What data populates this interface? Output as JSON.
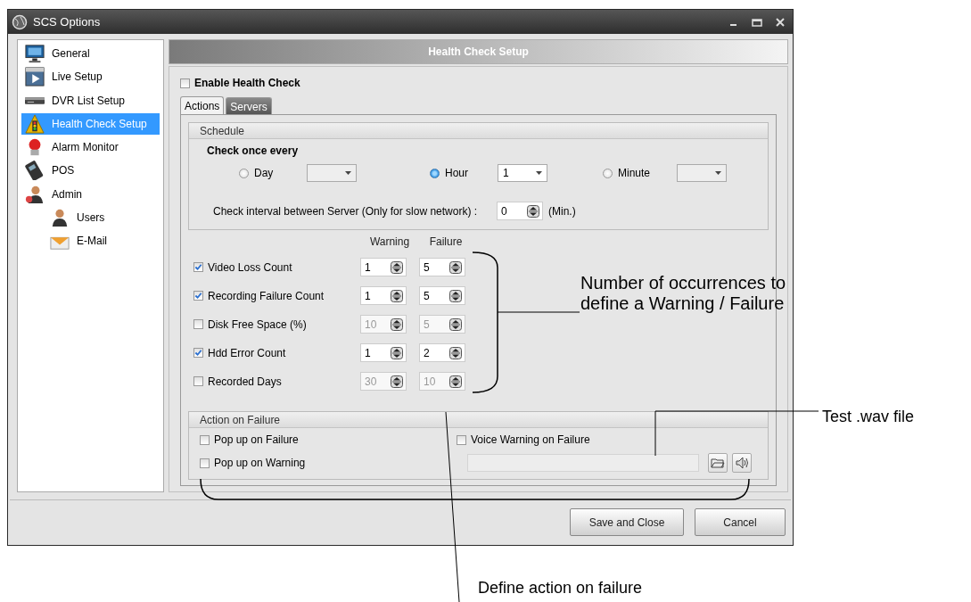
{
  "window": {
    "title": "SCS Options"
  },
  "sidebar": {
    "items": [
      {
        "label": "General",
        "selected": false
      },
      {
        "label": "Live Setup",
        "selected": false
      },
      {
        "label": "DVR List Setup",
        "selected": false
      },
      {
        "label": "Health Check Setup",
        "selected": true
      },
      {
        "label": "Alarm Monitor",
        "selected": false
      },
      {
        "label": "POS",
        "selected": false
      },
      {
        "label": "Admin",
        "selected": false,
        "children": [
          {
            "label": "Users",
            "selected": false
          },
          {
            "label": "E-Mail",
            "selected": false
          }
        ]
      }
    ]
  },
  "panel": {
    "title": "Health Check Setup",
    "enable": {
      "label": "Enable Health Check",
      "checked": false
    },
    "tabs": [
      {
        "label": "Actions",
        "selected": true
      },
      {
        "label": "Servers",
        "selected": false
      }
    ],
    "schedule": {
      "title": "Schedule",
      "heading": "Check once every",
      "options": [
        {
          "label": "Day",
          "selected": false
        },
        {
          "label": "Hour",
          "selected": true,
          "value": "1"
        },
        {
          "label": "Minute",
          "selected": false
        }
      ],
      "interval": {
        "label": "Check interval between Server (Only for slow network) :",
        "value": "0",
        "unit": "(Min.)"
      }
    },
    "thresholds": {
      "columns": [
        "Warning",
        "Failure"
      ],
      "rows": [
        {
          "label": "Video Loss Count",
          "checked": true,
          "warning": "1",
          "failure": "5"
        },
        {
          "label": "Recording Failure Count",
          "checked": true,
          "warning": "1",
          "failure": "5"
        },
        {
          "label": "Disk Free Space (%)",
          "checked": false,
          "warning": "10",
          "failure": "5"
        },
        {
          "label": "Hdd Error Count",
          "checked": true,
          "warning": "1",
          "failure": "2"
        },
        {
          "label": "Recorded Days",
          "checked": false,
          "warning": "30",
          "failure": "10"
        }
      ]
    },
    "action_on_failure": {
      "title": "Action on Failure",
      "options": [
        {
          "label": "Pop up on Failure",
          "checked": false
        },
        {
          "label": "Pop up on Warning",
          "checked": false
        }
      ],
      "voice": {
        "label": "Voice Warning on Failure",
        "checked": false
      }
    }
  },
  "buttons": [
    "Save and Close",
    "Cancel"
  ],
  "annotations": [
    "Number of occurrences to define a Warning / Failure",
    "Test .wav file",
    "Define action on failure"
  ]
}
